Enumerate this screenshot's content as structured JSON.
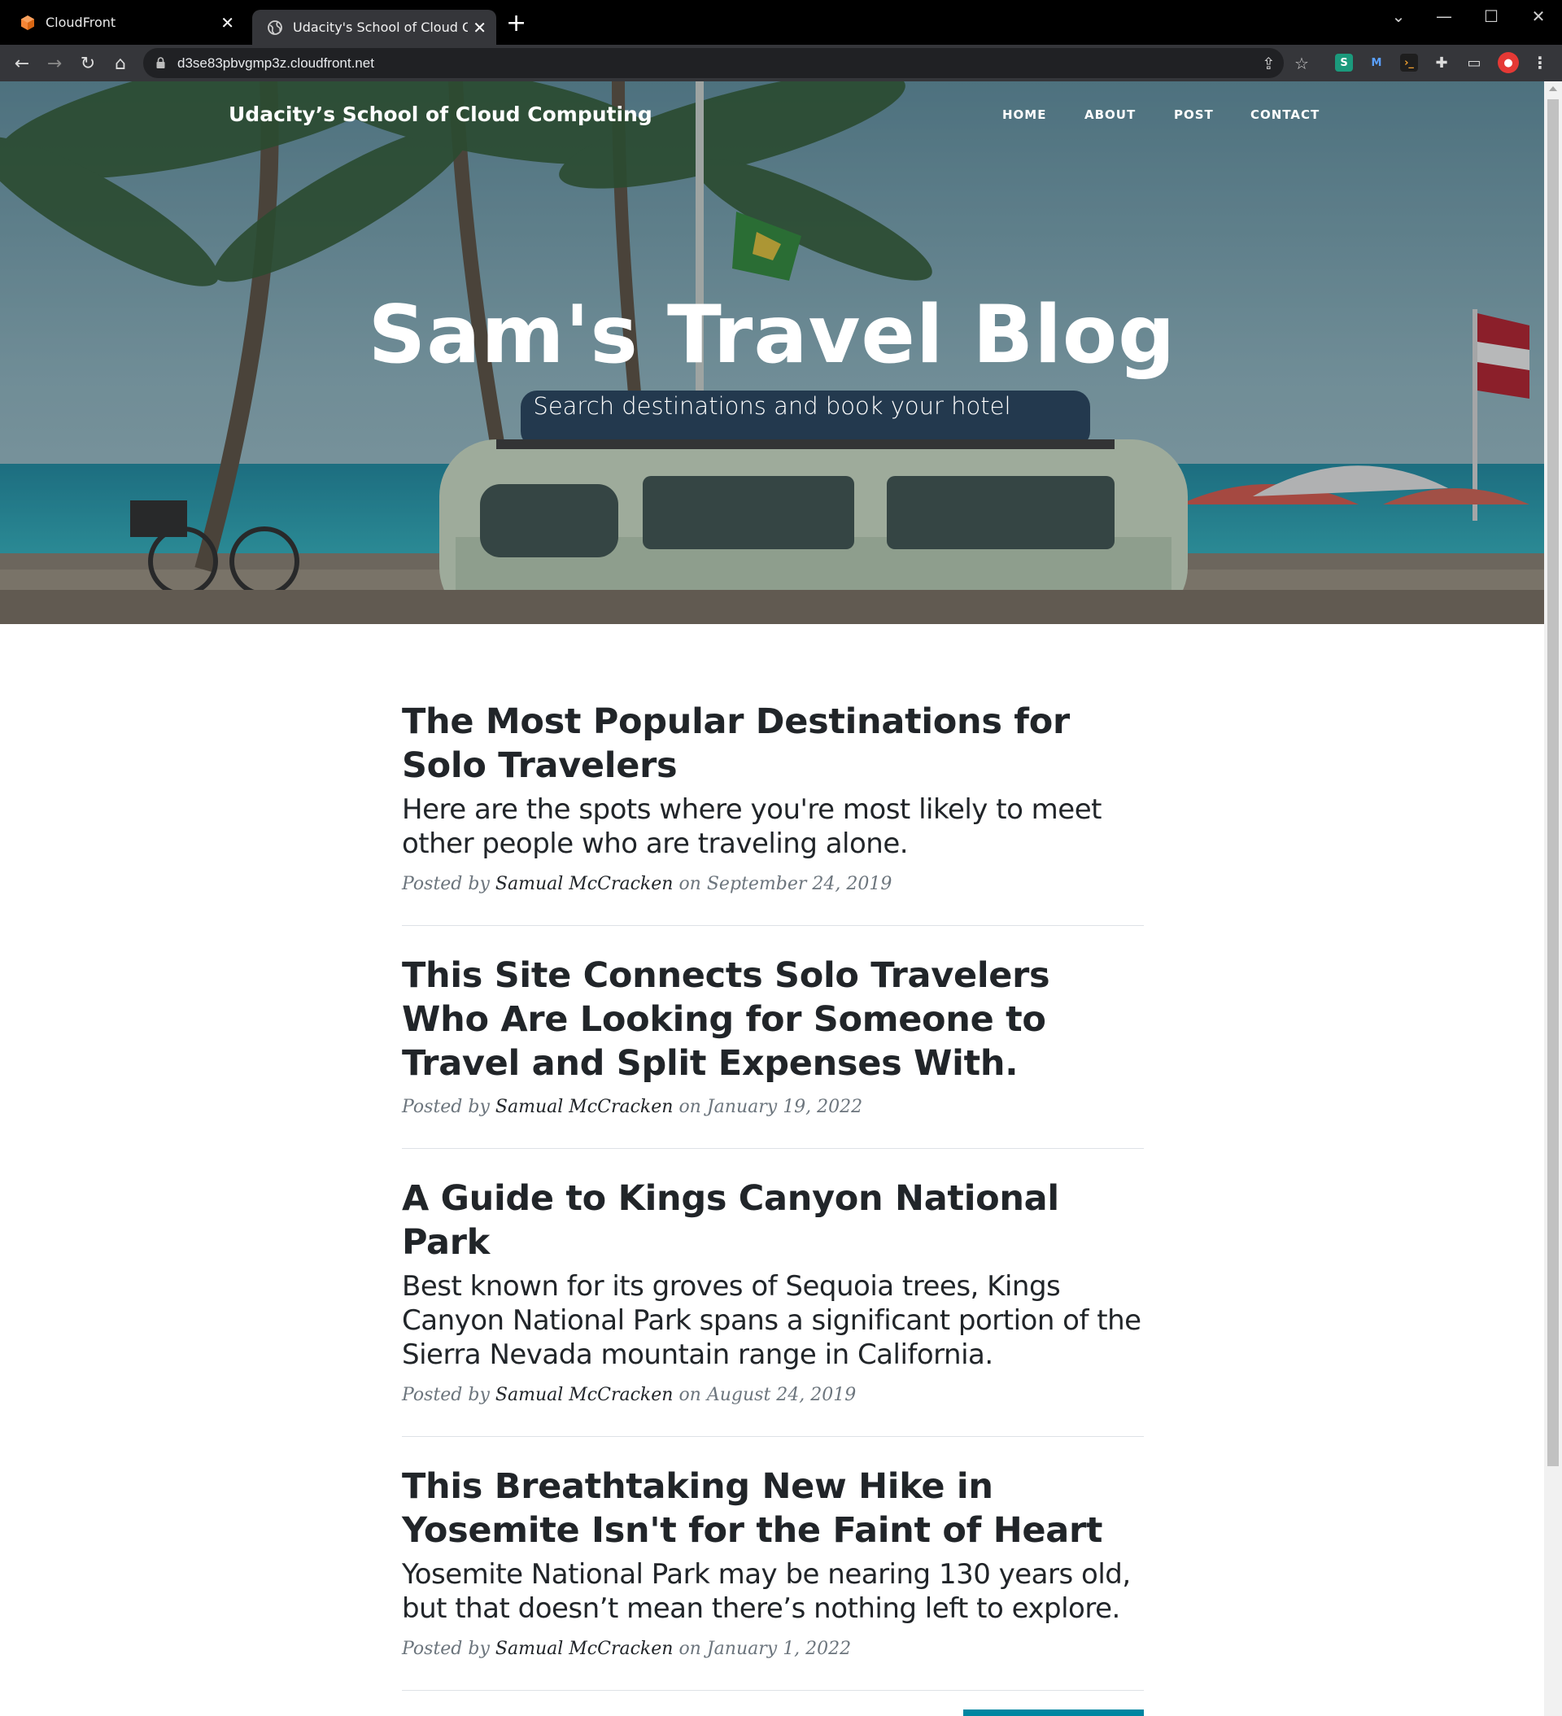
{
  "browser": {
    "tabs": [
      {
        "title": "CloudFront",
        "active": false
      },
      {
        "title": "Udacity's School of Cloud Computing",
        "active": true
      }
    ],
    "url": "d3se83pbvgmp3z.cloudfront.net"
  },
  "site": {
    "brand": "Udacity’s School of Cloud Computing",
    "nav": [
      "HOME",
      "ABOUT",
      "POST",
      "CONTACT"
    ],
    "hero_title": "Sam's Travel Blog",
    "hero_subtitle": "Search destinations and book your hotel"
  },
  "posts": [
    {
      "title": "The Most Popular Destinations for Solo Travelers",
      "subtitle": "Here are the spots where you're most likely to meet other people who are traveling alone.",
      "posted_by": "Posted by",
      "author": "Samual McCracken",
      "on": "on",
      "date": "September 24, 2019"
    },
    {
      "title": "This Site Connects Solo Travelers Who Are Looking for Someone to Travel and Split Expenses With.",
      "subtitle": "",
      "posted_by": "Posted by",
      "author": "Samual McCracken",
      "on": "on",
      "date": "January 19, 2022"
    },
    {
      "title": "A Guide to Kings Canyon National Park",
      "subtitle": "Best known for its groves of Sequoia trees, Kings Canyon National Park spans a significant portion of the Sierra Nevada mountain range in California.",
      "posted_by": "Posted by",
      "author": "Samual McCracken",
      "on": "on",
      "date": "August 24, 2019"
    },
    {
      "title": "This Breathtaking New Hike in Yosemite Isn't for the Faint of Heart",
      "subtitle": "Yosemite National Park may be nearing 130 years old, but that doesn’t mean there’s nothing left to explore.",
      "posted_by": "Posted by",
      "author": "Samual McCracken",
      "on": "on",
      "date": "January 1, 2022"
    }
  ],
  "colors": {
    "accent": "#0085a1",
    "heading": "#212529",
    "meta": "#6c757d"
  }
}
